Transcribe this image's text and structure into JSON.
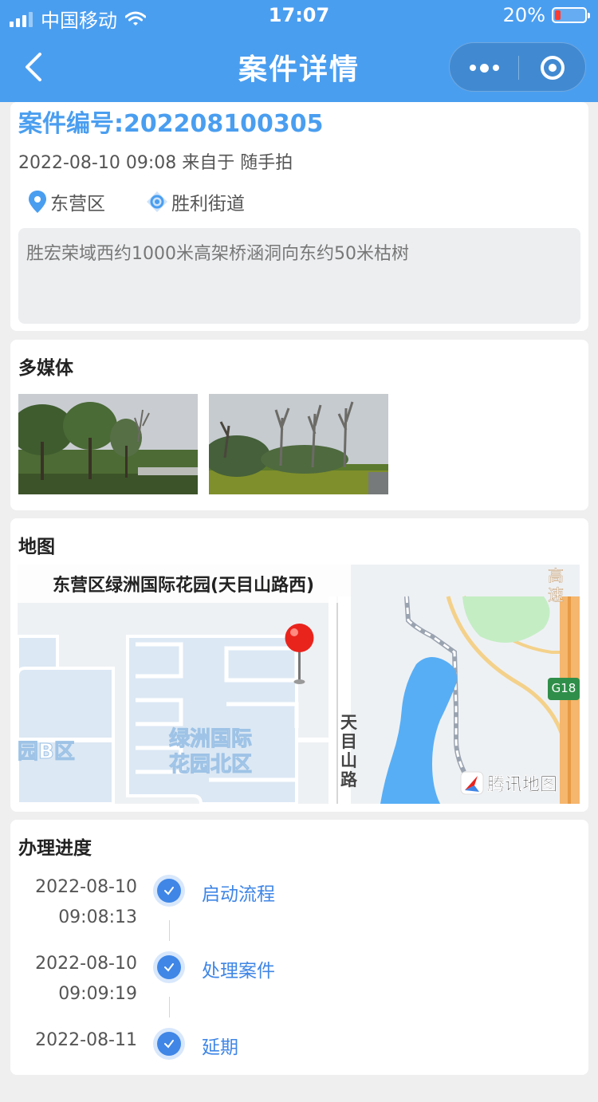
{
  "status_bar": {
    "carrier": "中国移动",
    "time": "17:07",
    "battery": "20%",
    "battery_level": 0.2
  },
  "nav": {
    "title": "案件详情"
  },
  "case": {
    "number": "案件编号:202208100305",
    "meta": "2022-08-10 09:08 来自于 随手拍",
    "district": "东营区",
    "street": "胜利街道",
    "description": "胜宏荣域西约1000米高架桥涵洞向东约50米枯树"
  },
  "media": {
    "title": "多媒体"
  },
  "map": {
    "title": "地图",
    "address": "东营区绿洲国际花园(天目山路西)",
    "labels": {
      "area_b": "园B区",
      "garden_line1": "绿洲国际",
      "garden_line2": "花园北区",
      "road_vertical": [
        "天",
        "目",
        "山",
        "路"
      ],
      "highway_vertical": [
        "高",
        "速"
      ],
      "highway_badge": "G18",
      "logo": "腾讯地图"
    }
  },
  "progress": {
    "title": "办理进度",
    "steps": [
      {
        "date": "2022-08-10",
        "time": "09:08:13",
        "label": "启动流程"
      },
      {
        "date": "2022-08-10",
        "time": "09:09:19",
        "label": "处理案件"
      },
      {
        "date": "2022-08-11",
        "time": "",
        "label": "延期"
      }
    ]
  },
  "colors": {
    "primary": "#4a9ef0",
    "step": "#3f86e6",
    "water": "#57aef5"
  }
}
